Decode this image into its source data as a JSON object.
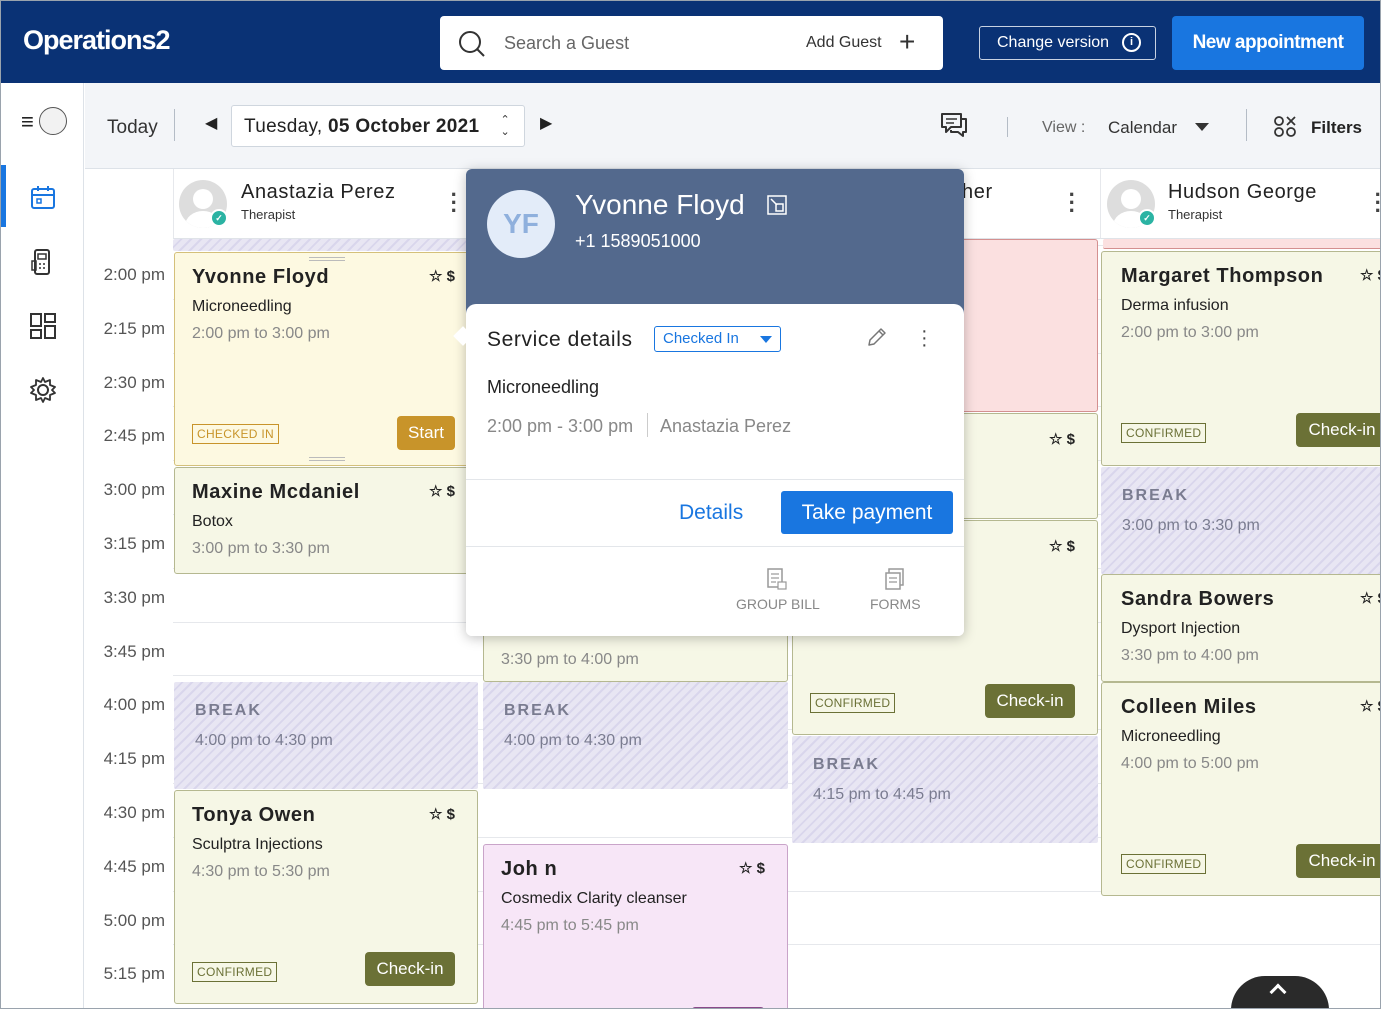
{
  "app": {
    "logo": "Operations2",
    "search_placeholder": "Search a Guest",
    "add_guest": "Add Guest",
    "change_version": "Change version",
    "new_appointment": "New appointment"
  },
  "toolbar": {
    "today": "Today",
    "date_weekday": "Tuesday,",
    "date_day": "05 October 2021",
    "view_label": "View :",
    "view_value": "Calendar",
    "filters": "Filters"
  },
  "times": [
    "2:00 pm",
    "2:15 pm",
    "2:30 pm",
    "2:45 pm",
    "3:00 pm",
    "3:15 pm",
    "3:30 pm",
    "3:45 pm",
    "4:00 pm",
    "4:15 pm",
    "4:30 pm",
    "4:45 pm",
    "5:00 pm",
    "5:15 pm"
  ],
  "staff": [
    {
      "name": "Anastazia Perez",
      "role": "Therapist"
    },
    {
      "name": "her",
      "role": ""
    },
    {
      "name": "Hudson George",
      "role": "Therapist"
    }
  ],
  "appointments": {
    "a1": {
      "name": "Yvonne Floyd",
      "service": "Microneedling",
      "time": "2:00 pm to 3:00 pm",
      "badge": "CHECKED IN",
      "button": "Start"
    },
    "a2": {
      "name": "Maxine Mcdaniel",
      "service": "Botox",
      "time": "3:00 pm to 3:30 pm"
    },
    "a3": {
      "name": "Tonya Owen",
      "service": "Sculptra Injections",
      "time": "4:30 pm to 5:30 pm",
      "badge": "CONFIRMED",
      "button": "Check-in"
    },
    "a4": {
      "time": "3:30 pm to 4:00 pm"
    },
    "a5": {
      "name": "Joh n",
      "service": "Cosmedix Clarity cleanser",
      "time": "4:45 pm to 5:45 pm"
    },
    "a6": {
      "badge": "CONFIRMED",
      "button": "Check-in"
    },
    "a7": {
      "name": "Margaret Thompson",
      "service": "Derma infusion",
      "time": "2:00 pm to 3:00 pm",
      "badge": "CONFIRMED",
      "button": "Check-in"
    },
    "a8": {
      "name": "Sandra Bowers",
      "service": "Dysport Injection",
      "time": "3:30 pm to 4:00 pm"
    },
    "a9": {
      "name": "Colleen Miles",
      "service": "Microneedling",
      "time": "4:00 pm to 5:00 pm",
      "badge": "CONFIRMED",
      "button": "Check-in"
    }
  },
  "breaks": {
    "b1": {
      "label": "BREAK",
      "time": "4:00 pm to 4:30 pm"
    },
    "b2": {
      "label": "BREAK",
      "time": "4:00 pm to 4:30 pm"
    },
    "b3": {
      "label": "BREAK",
      "time": "4:15 pm to 4:45 pm"
    },
    "b4": {
      "label": "BREAK",
      "time": "3:00 pm to 3:30 pm"
    }
  },
  "popup": {
    "initials": "YF",
    "name": "Yvonne Floyd",
    "phone": "+1 1589051000",
    "section_title": "Service details",
    "status": "Checked In",
    "service": "Microneedling",
    "time": "2:00 pm - 3:00 pm",
    "staff": "Anastazia Perez",
    "details": "Details",
    "take_payment": "Take payment",
    "group_bill": "GROUP BILL",
    "forms": "FORMS"
  },
  "colors": {
    "topbar": "#0a3275",
    "primary": "#1976e0",
    "popup_header": "#53698d",
    "checkin_button": "#6b7136",
    "start_button": "#c8942a"
  }
}
